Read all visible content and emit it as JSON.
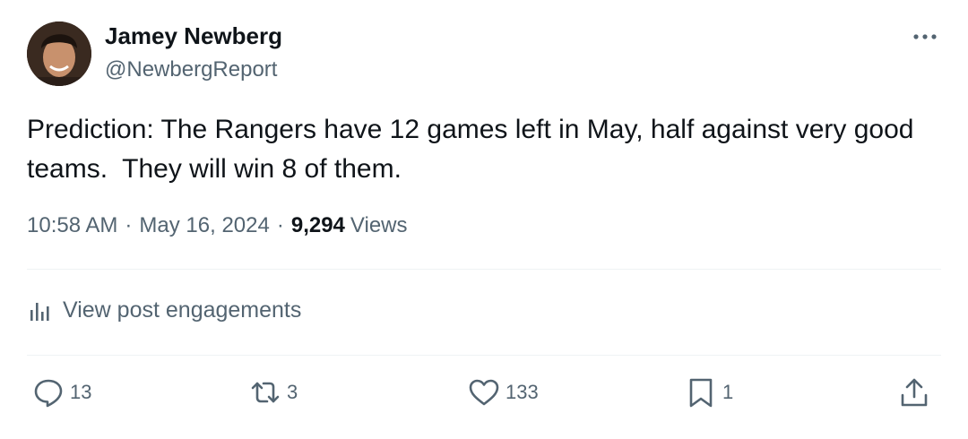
{
  "author": {
    "name": "Jamey Newberg",
    "handle": "@NewbergReport"
  },
  "post": {
    "text": "Prediction: The Rangers have 12 games left in May, half against very good teams.  They will win 8 of them.",
    "time": "10:58 AM",
    "date": "May 16, 2024",
    "separator": "·",
    "views_count": "9,294",
    "views_label": "Views"
  },
  "engagements": {
    "label": "View post engagements"
  },
  "actions": {
    "replies": "13",
    "reposts": "3",
    "likes": "133",
    "bookmarks": "1"
  },
  "icons": {
    "more": "more-dots-icon",
    "analytics": "bar-chart-icon",
    "reply": "speech-bubble-icon",
    "repost": "repost-arrows-icon",
    "like": "heart-icon",
    "bookmark": "bookmark-icon",
    "share": "share-upload-icon"
  },
  "colors": {
    "text_primary": "#0f1419",
    "text_secondary": "#536471",
    "divider": "#eff3f4"
  }
}
